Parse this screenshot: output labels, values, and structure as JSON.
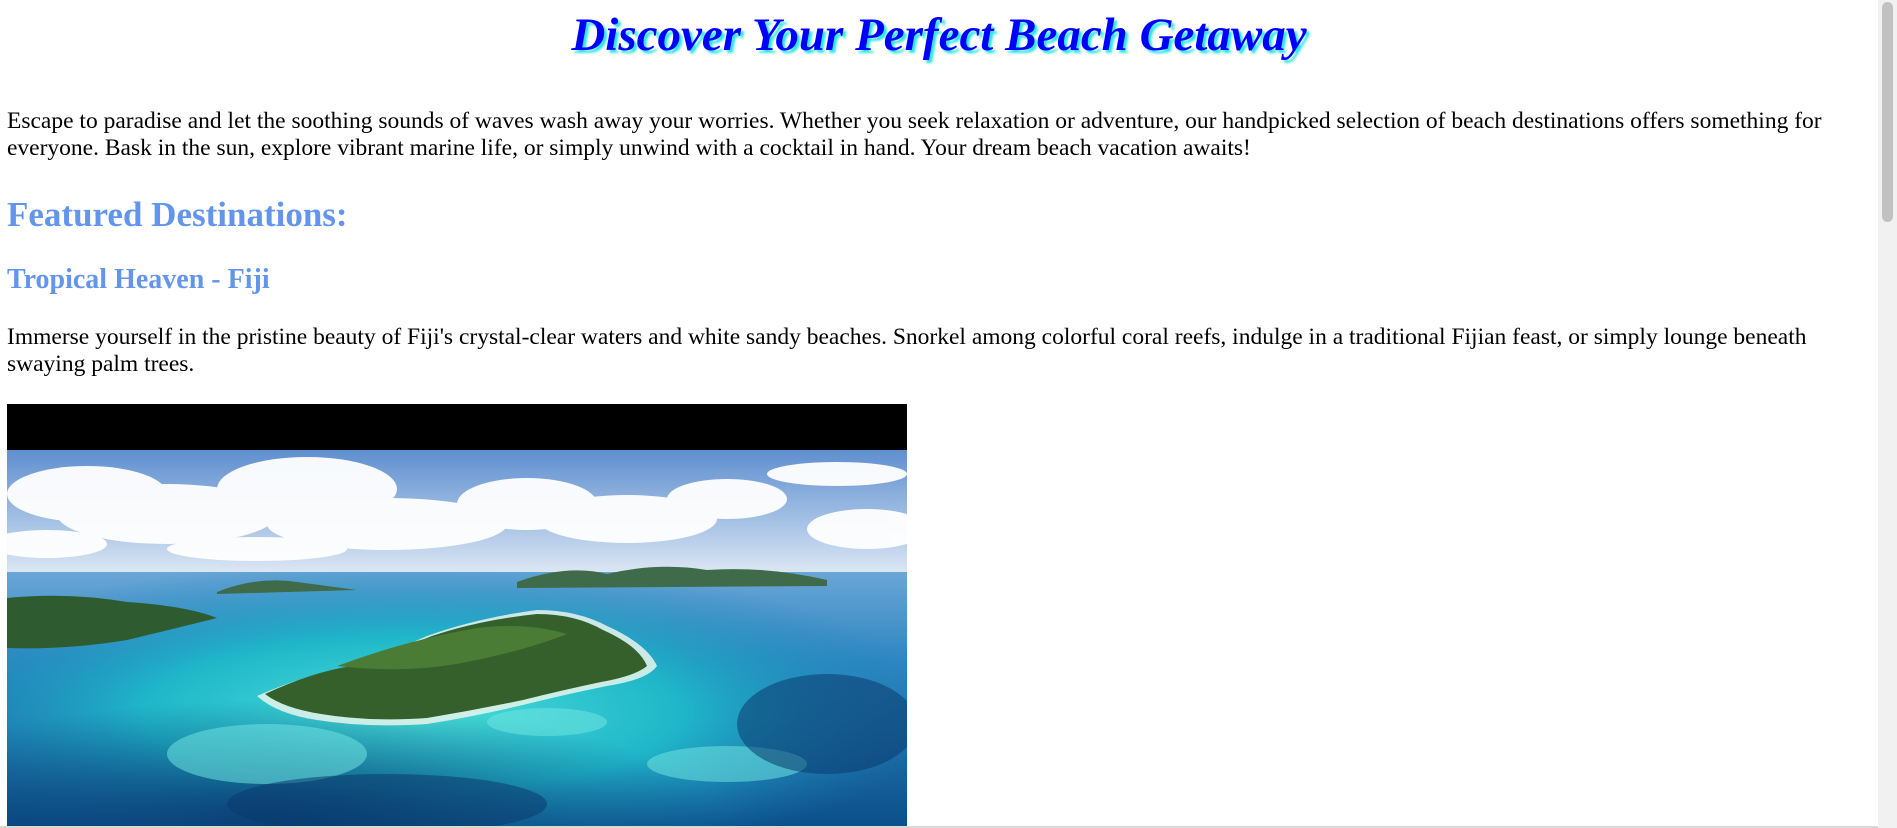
{
  "header": {
    "title": "Discover Your Perfect Beach Getaway"
  },
  "intro": {
    "text": "Escape to paradise and let the soothing sounds of waves wash away your worries. Whether you seek relaxation or adventure, our handpicked selection of beach destinations offers something for everyone. Bask in the sun, explore vibrant marine life, or simply unwind with a cocktail in hand. Your dream beach vacation awaits!"
  },
  "featured": {
    "heading": "Featured Destinations:",
    "destinations": [
      {
        "name": "Tropical Heaven - Fiji",
        "description": "Immerse yourself in the pristine beauty of Fiji's crystal-clear waters and white sandy beaches. Snorkel among colorful coral reefs, indulge in a traditional Fijian feast, or simply lounge beneath swaying palm trees."
      }
    ]
  },
  "colors": {
    "title": "#0000ff",
    "title_shadow": "#33e6e6",
    "heading": "#6495ed",
    "body_text": "#000000"
  }
}
